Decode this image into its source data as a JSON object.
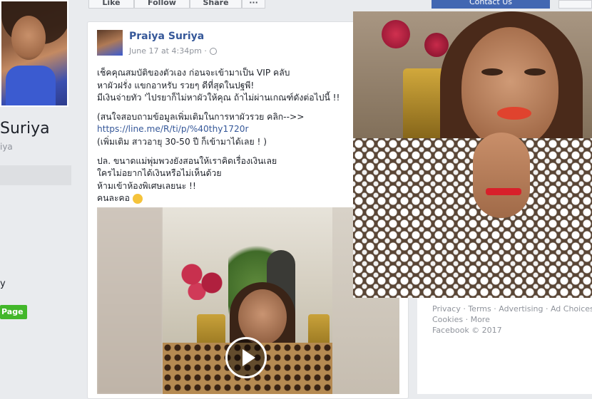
{
  "toolbar": {
    "like_label": "Like",
    "follow_label": "Follow",
    "share_label": "Share",
    "more_label": "···",
    "contact_label": "Contact Us"
  },
  "profile": {
    "name": "Suriya",
    "handle": "iya",
    "truncated_text": "y",
    "like_page_label": "Page"
  },
  "post": {
    "author": "Praiya Suriya",
    "time": "June 17 at 4:34pm ·",
    "lines": [
      "เช็คคุณสมบัติของตัวเอง ก่อนจะเข้ามาเป็น VIP คลับ",
      "หาผัวฝรั่ง แขกอาหรับ รวยๆ ดีที่สุดในปฐพี!",
      "มีเงินจ่ายทัว 'ไปรยาก็ไม่หาผัวให้คุณ ถ้าไม่ผ่านเกณฑ์ดังต่อไปนี้ !!",
      "(สนใจสอบถามข้อมูลเพิ่มเติมในการหาผัวรวย คลิก-->>",
      "https://line.me/R/ti/p/%40thy1720r",
      "(เพิ่มเติม สาวอายุ 30-50 ปี ก็เข้ามาได้เลย ! )",
      "ปล. ขนาดแม่พุ่มพวงยังสอนให้เราคิดเรื่องเงินเลย",
      "ใครไม่อยากได้เงินหรือไม่เห็นด้วย",
      "ห้ามเข้าห้องพิเศษเลยนะ !!",
      "คนละคอ"
    ]
  },
  "footer": {
    "privacy": "Privacy",
    "terms": "Terms",
    "advertising": "Advertising",
    "ad_choices": "Ad Choices",
    "cookies": "Cookies",
    "more": "More",
    "copyright": "Facebook © 2017",
    "sep": " · "
  },
  "colors": {
    "link": "#365899",
    "like_page": "#42b72a",
    "contact": "#4267b2",
    "bg": "#e9ebee"
  }
}
